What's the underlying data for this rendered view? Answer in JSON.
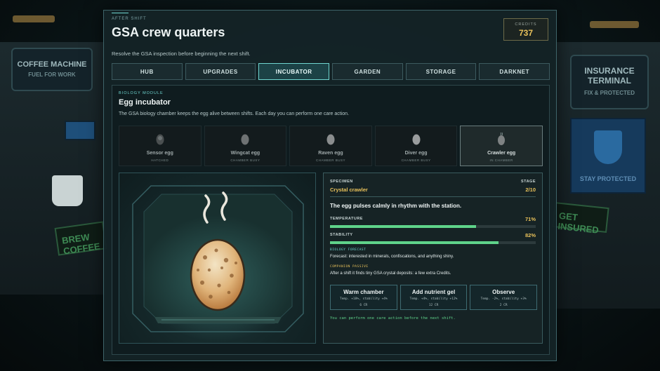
{
  "background": {
    "coffee_sign": "COFFEE MACHINE",
    "coffee_sub": "FUEL FOR WORK",
    "brew": "BREW COFFEE",
    "insurance_sign": "INSURANCE TERMINAL",
    "insurance_sub": "FIX & PROTECTED",
    "stay": "STAY PROTECTED",
    "get_insured": "GET INSURED"
  },
  "header": {
    "eyebrow": "After shift",
    "title": "GSA crew quarters",
    "subtitle": "Resolve the GSA inspection before beginning the next shift.",
    "credits_label": "Credits",
    "credits_value": "737"
  },
  "tabs": [
    {
      "label": "HUB",
      "active": false
    },
    {
      "label": "UPGRADES",
      "active": false
    },
    {
      "label": "INCUBATOR",
      "active": true
    },
    {
      "label": "GARDEN",
      "active": false
    },
    {
      "label": "STORAGE",
      "active": false
    },
    {
      "label": "DARKNET",
      "active": false
    }
  ],
  "module": {
    "label": "Biology module",
    "title": "Egg incubator",
    "description": "The GSA biology chamber keeps the egg alive between shifts. Each day you can perform one care action."
  },
  "eggs": [
    {
      "name": "Sensor egg",
      "status": "HATCHED",
      "selected": false
    },
    {
      "name": "Wingcat egg",
      "status": "CHAMBER BUSY",
      "selected": false
    },
    {
      "name": "Raven egg",
      "status": "CHAMBER BUSY",
      "selected": false
    },
    {
      "name": "Diver egg",
      "status": "CHAMBER BUSY",
      "selected": false
    },
    {
      "name": "Crawler egg",
      "status": "IN CHAMBER",
      "selected": true
    }
  ],
  "specimen": {
    "label": "Specimen",
    "name": "Crystal crawler",
    "stage_label": "Stage",
    "stage_value": "2/10",
    "status_line": "The egg pulses calmly in rhythm with the station.",
    "temperature_label": "Temperature",
    "temperature_pct": "71%",
    "temperature": 71,
    "stability_label": "Stability",
    "stability_pct": "82%",
    "stability": 82,
    "forecast_label": "Biology forecast",
    "forecast_text": "Forecast: interested in minerals, confiscations, and anything shiny.",
    "companion_label": "Companion passive",
    "companion_text": "After a shift it finds tiny GSA crystal deposits: a few extra Credits."
  },
  "actions": [
    {
      "name": "Warm chamber",
      "effect": "Temp. +18%, stability +4%",
      "cost": "6 CR"
    },
    {
      "name": "Add nutrient gel",
      "effect": "Temp. +4%, stability +12%",
      "cost": "12 CR"
    },
    {
      "name": "Observe",
      "effect": "Temp. -2%, stability +3%",
      "cost": "2 CR"
    }
  ],
  "footnote": "You can perform one care action before the next shift.",
  "colors": {
    "accent": "#6fd6d0",
    "gold": "#e8c15a",
    "meter": "#5fd38a"
  }
}
